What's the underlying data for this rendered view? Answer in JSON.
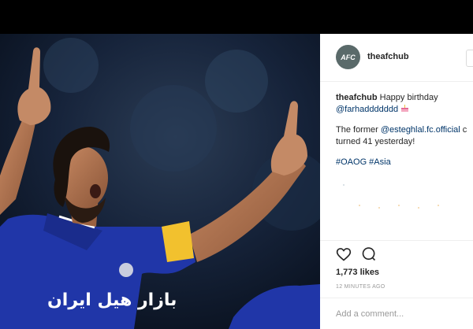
{
  "post": {
    "avatar_text": "AFC",
    "username": "theafchub",
    "caption_line1": "Happy birthday",
    "caption_mention": "@farhaddddddd",
    "caption_p2_start": "The former",
    "caption_p2_mention": "@esteghlal.fc.official",
    "caption_p2_tail": "c",
    "caption_p2_line2": "turned 41 yesterday!",
    "hashtags": "#OAOG #Asia",
    "likes": "1,773 likes",
    "time": "12 MINUTES AGO",
    "comment_placeholder": "Add a comment..."
  },
  "photo": {
    "jersey_text": "بازار هیل ایران"
  },
  "colors": {
    "link": "#003569",
    "jersey": "#2036a8",
    "armband": "#f2c12e"
  }
}
